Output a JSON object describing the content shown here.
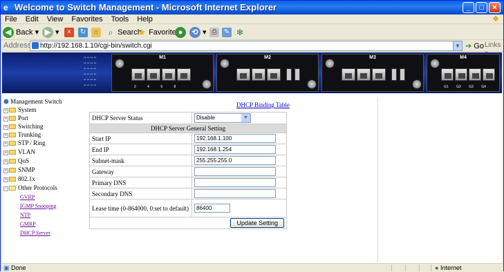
{
  "window": {
    "title": "Welcome to Switch Management - Microsoft Internet Explorer"
  },
  "menu": [
    "File",
    "Edit",
    "View",
    "Favorites",
    "Tools",
    "Help"
  ],
  "toolbar": {
    "back": "Back",
    "search": "Search",
    "favorites": "Favorites"
  },
  "address": {
    "label": "Address",
    "url": "http://192.168.1.10/cgi-bin/switch.cgi",
    "go": "Go",
    "links": "Links"
  },
  "banner": {
    "modules": [
      "M1",
      "M2",
      "M3",
      "M4"
    ],
    "m1_ports": [
      "2",
      "4",
      "6",
      "8"
    ],
    "m4_ports": [
      "G1",
      "G2",
      "G3",
      "G4"
    ]
  },
  "sidebar": {
    "root": "Management Switch",
    "items": [
      "System",
      "Port",
      "Switching",
      "Trunking",
      "STP / Ring",
      "VLAN",
      "QoS",
      "SNMP",
      "802.1x",
      "Other Protocols"
    ],
    "subitems": [
      "GVRP",
      "IGMP Snooping",
      "NTP",
      "GMRP",
      "DHCP Server"
    ]
  },
  "main": {
    "binding_link": "DHCP Binding Table",
    "status_label": "DHCP Server Status",
    "status_value": "Disable",
    "section_header": "DHCP Server General Setting",
    "fields": [
      {
        "label": "Start IP",
        "value": "192.168.1.100"
      },
      {
        "label": "End IP",
        "value": "192.168.1.254"
      },
      {
        "label": "Subnet-mask",
        "value": "255.255.255.0"
      },
      {
        "label": "Gateway",
        "value": ""
      },
      {
        "label": "Primary DNS",
        "value": ""
      },
      {
        "label": "Secondary DNS",
        "value": ""
      }
    ],
    "lease_label": "Lease time (0-864000, 0:set to default)",
    "lease_value": "86400",
    "update_button": "Update Setting"
  },
  "status": {
    "text": "Done",
    "zone": "Internet"
  },
  "colors": {
    "titlebar": "#0a5fe6",
    "link_visited": "#6a0e8a",
    "link": "#0000cc"
  }
}
